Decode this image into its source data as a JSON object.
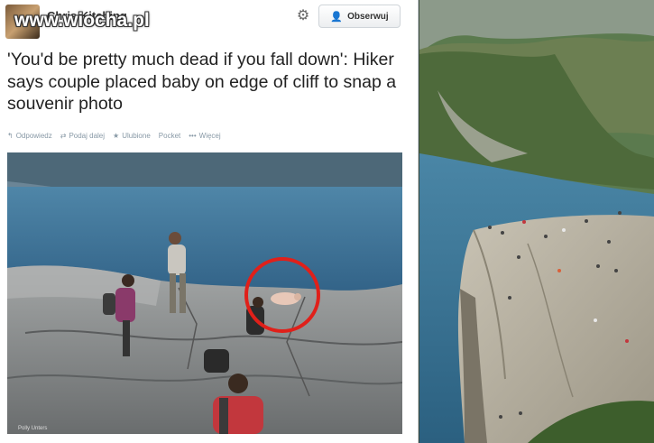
{
  "watermark": "www.wiocha.pl",
  "tweet": {
    "author": "Chris Kitching",
    "handle": "",
    "follow_label": "Obserwuj",
    "text": "'You'd be pretty much dead if you fall down': Hiker says couple placed baby on edge of cliff to snap a souvenir photo",
    "actions": [
      {
        "icon": "reply-icon",
        "glyph": "↰",
        "label": "Odpowiedz"
      },
      {
        "icon": "retweet-icon",
        "glyph": "⇄",
        "label": "Podaj dalej"
      },
      {
        "icon": "star-icon",
        "glyph": "★",
        "label": "Ulubione"
      },
      {
        "icon": "pocket-icon",
        "glyph": "",
        "label": "Pocket"
      },
      {
        "icon": "more-icon",
        "glyph": "•••",
        "label": "Więcej"
      }
    ],
    "photo_credit": "Polly Unters"
  },
  "colors": {
    "water": "#3b6f93",
    "rock": "#8e9193",
    "circle": "#e0201a",
    "link": "#2b7bb9"
  },
  "icons": {
    "gear": "gear-icon",
    "follow": "add-user-icon"
  }
}
